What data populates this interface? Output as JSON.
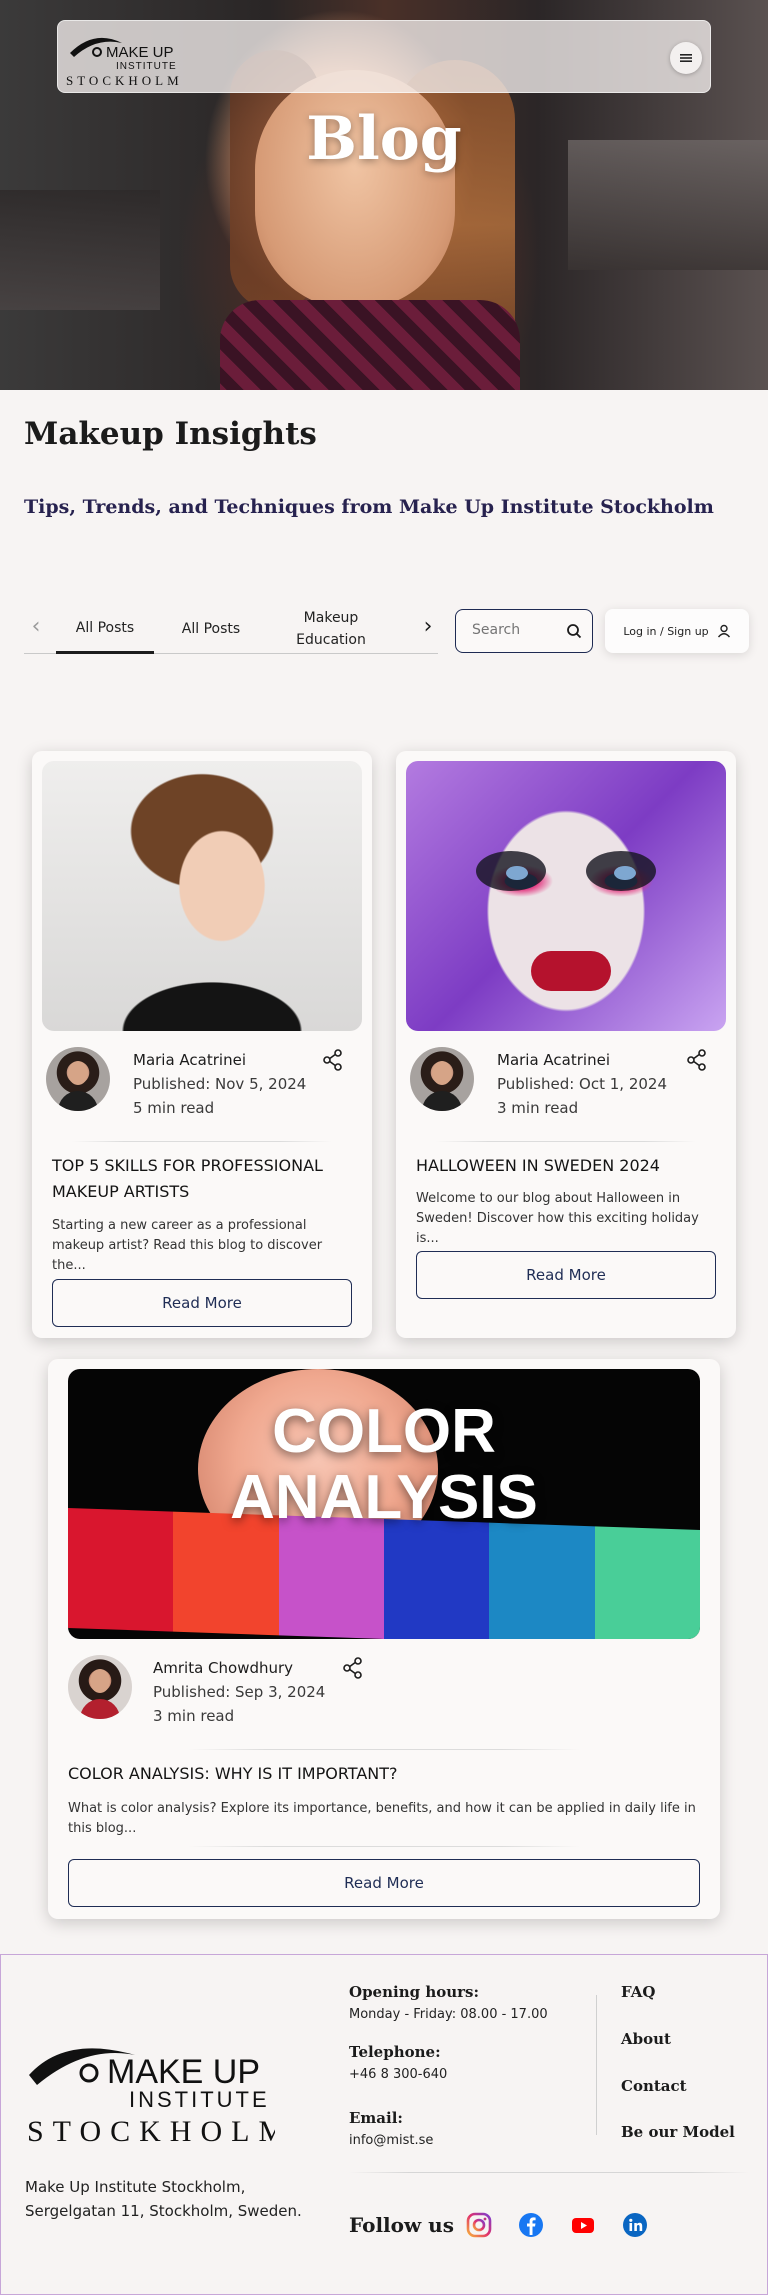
{
  "hero": {
    "title": "Blog",
    "logo": {
      "line1": "MAKE UP",
      "line2": "INSTITUTE",
      "line3": "STOCKHOLM"
    }
  },
  "nav": {
    "menu_icon": "hamburger-icon"
  },
  "page": {
    "title": "Makeup Insights",
    "subtitle": "Tips, Trends, and Techniques from Make Up Institute Stockholm"
  },
  "filters": {
    "tabs": [
      {
        "label": "All Posts"
      },
      {
        "label": "All Posts"
      },
      {
        "label": "Makeup Education"
      }
    ],
    "search_placeholder": "Search",
    "login_label": "Log in / Sign up"
  },
  "posts": [
    {
      "author": "Maria Acatrinei",
      "published": "Published: Nov 5, 2024",
      "read_time": "5 min read",
      "title": "TOP 5 SKILLS FOR PROFESSIONAL MAKEUP ARTISTS",
      "excerpt": "Starting a new career as a professional makeup artist? Read this blog to discover the...",
      "button": "Read More"
    },
    {
      "author": "Maria Acatrinei",
      "published": "Published: Oct 1, 2024",
      "read_time": "3 min read",
      "title": "HALLOWEEN IN SWEDEN 2024",
      "excerpt": "Welcome to our blog about Halloween in Sweden! Discover how this exciting holiday is...",
      "button": "Read More"
    },
    {
      "author": "Amrita Chowdhury",
      "published": "Published: Sep 3, 2024",
      "read_time": "3 min read",
      "title": "COLOR ANALYSIS: WHY IS IT IMPORTANT?",
      "excerpt": "What is color analysis? Explore its importance, benefits, and how it can be applied in daily life in this blog...",
      "button": "Read More",
      "image_text": {
        "line1": "COLOR",
        "line2": "ANALYSIS"
      }
    }
  ],
  "footer": {
    "logo": {
      "line1": "MAKE UP",
      "line2": "INSTITUTE",
      "line3": "STOCKHOLM"
    },
    "address_line1": "Make Up Institute Stockholm,",
    "address_line2": "Sergelgatan 11, Stockholm, Sweden.",
    "hours_label": "Opening hours:",
    "hours_value": "Monday - Friday: 08.00  - 17.00",
    "phone_label": "Telephone:",
    "phone_value": "+46 8 300-640",
    "email_label": "Email:",
    "email_value": "info@mist.se",
    "links": [
      "FAQ",
      "About",
      "Contact",
      "Be our Model"
    ],
    "follow_label": "Follow us",
    "socials": [
      "instagram-icon",
      "facebook-icon",
      "youtube-icon",
      "linkedin-icon"
    ]
  }
}
